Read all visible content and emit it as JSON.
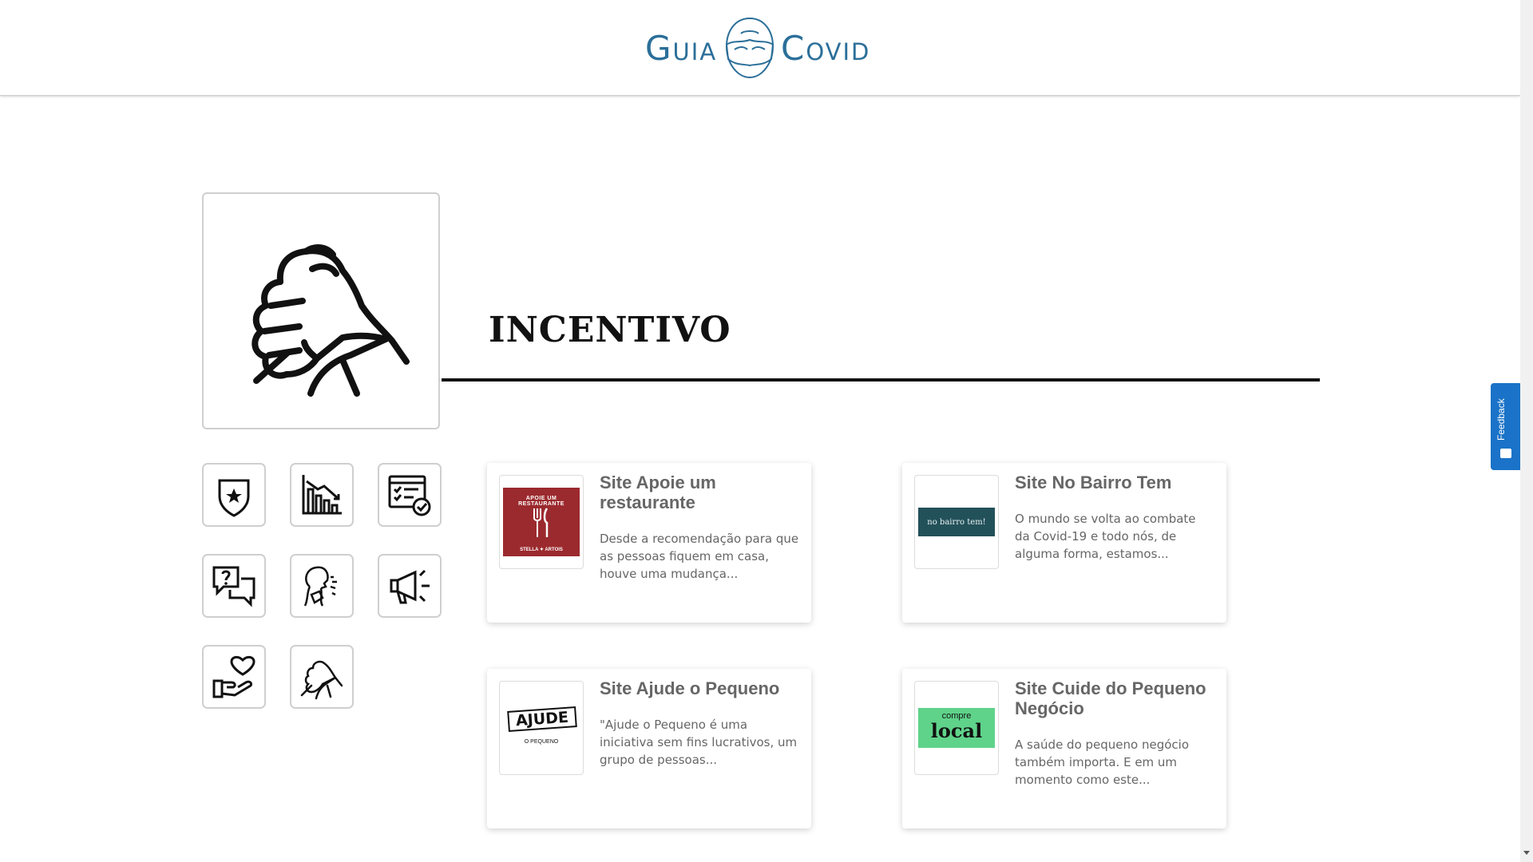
{
  "header": {
    "logo_word_1": "Guia",
    "logo_word_2": "Covid"
  },
  "colors": {
    "brand": "#2b6f99",
    "feedback": "#1a73c8",
    "title": "#111111",
    "card_text": "#666666"
  },
  "category": {
    "icon": "handshake-arm-wrestle-icon",
    "title": "INCENTIVO"
  },
  "category_buttons": [
    {
      "icon": "police-badge-icon"
    },
    {
      "icon": "economy-decline-chart-icon"
    },
    {
      "icon": "checklist-check-icon"
    },
    {
      "icon": "questions-chat-icon"
    },
    {
      "icon": "coughing-person-icon"
    },
    {
      "icon": "megaphone-icon"
    },
    {
      "icon": "heart-hand-icon"
    },
    {
      "icon": "handshake-icon"
    }
  ],
  "cards": [
    {
      "title": "Site Apoie um restaurante",
      "description": "Desde a recomendação para que as pessoas fiquem em casa, houve uma mudança...",
      "logo_text_top": "APOIE UM RESTAURANTE",
      "logo_text_bottom": "STELLA ✦ ARTOIS"
    },
    {
      "title": "Site No Bairro Tem",
      "description": "O mundo se volta ao combate da Covid-19 e todo nós, de alguma forma, estamos...",
      "logo_text": "no bairro tem!"
    },
    {
      "title": "Site Ajude o Pequeno",
      "description": "\"Ajude o Pequeno é uma iniciativa sem fins lucrativos, um grupo de pessoas...",
      "logo_text_top": "AJUDE",
      "logo_text_bottom": "O PEQUENO"
    },
    {
      "title": "Site Cuide do Pequeno Negócio",
      "description": "A saúde do pequeno negócio também importa. E em um momento como este...",
      "logo_text_top": "compre",
      "logo_text_bottom": "local"
    }
  ],
  "feedback": {
    "label": "Feedback"
  }
}
